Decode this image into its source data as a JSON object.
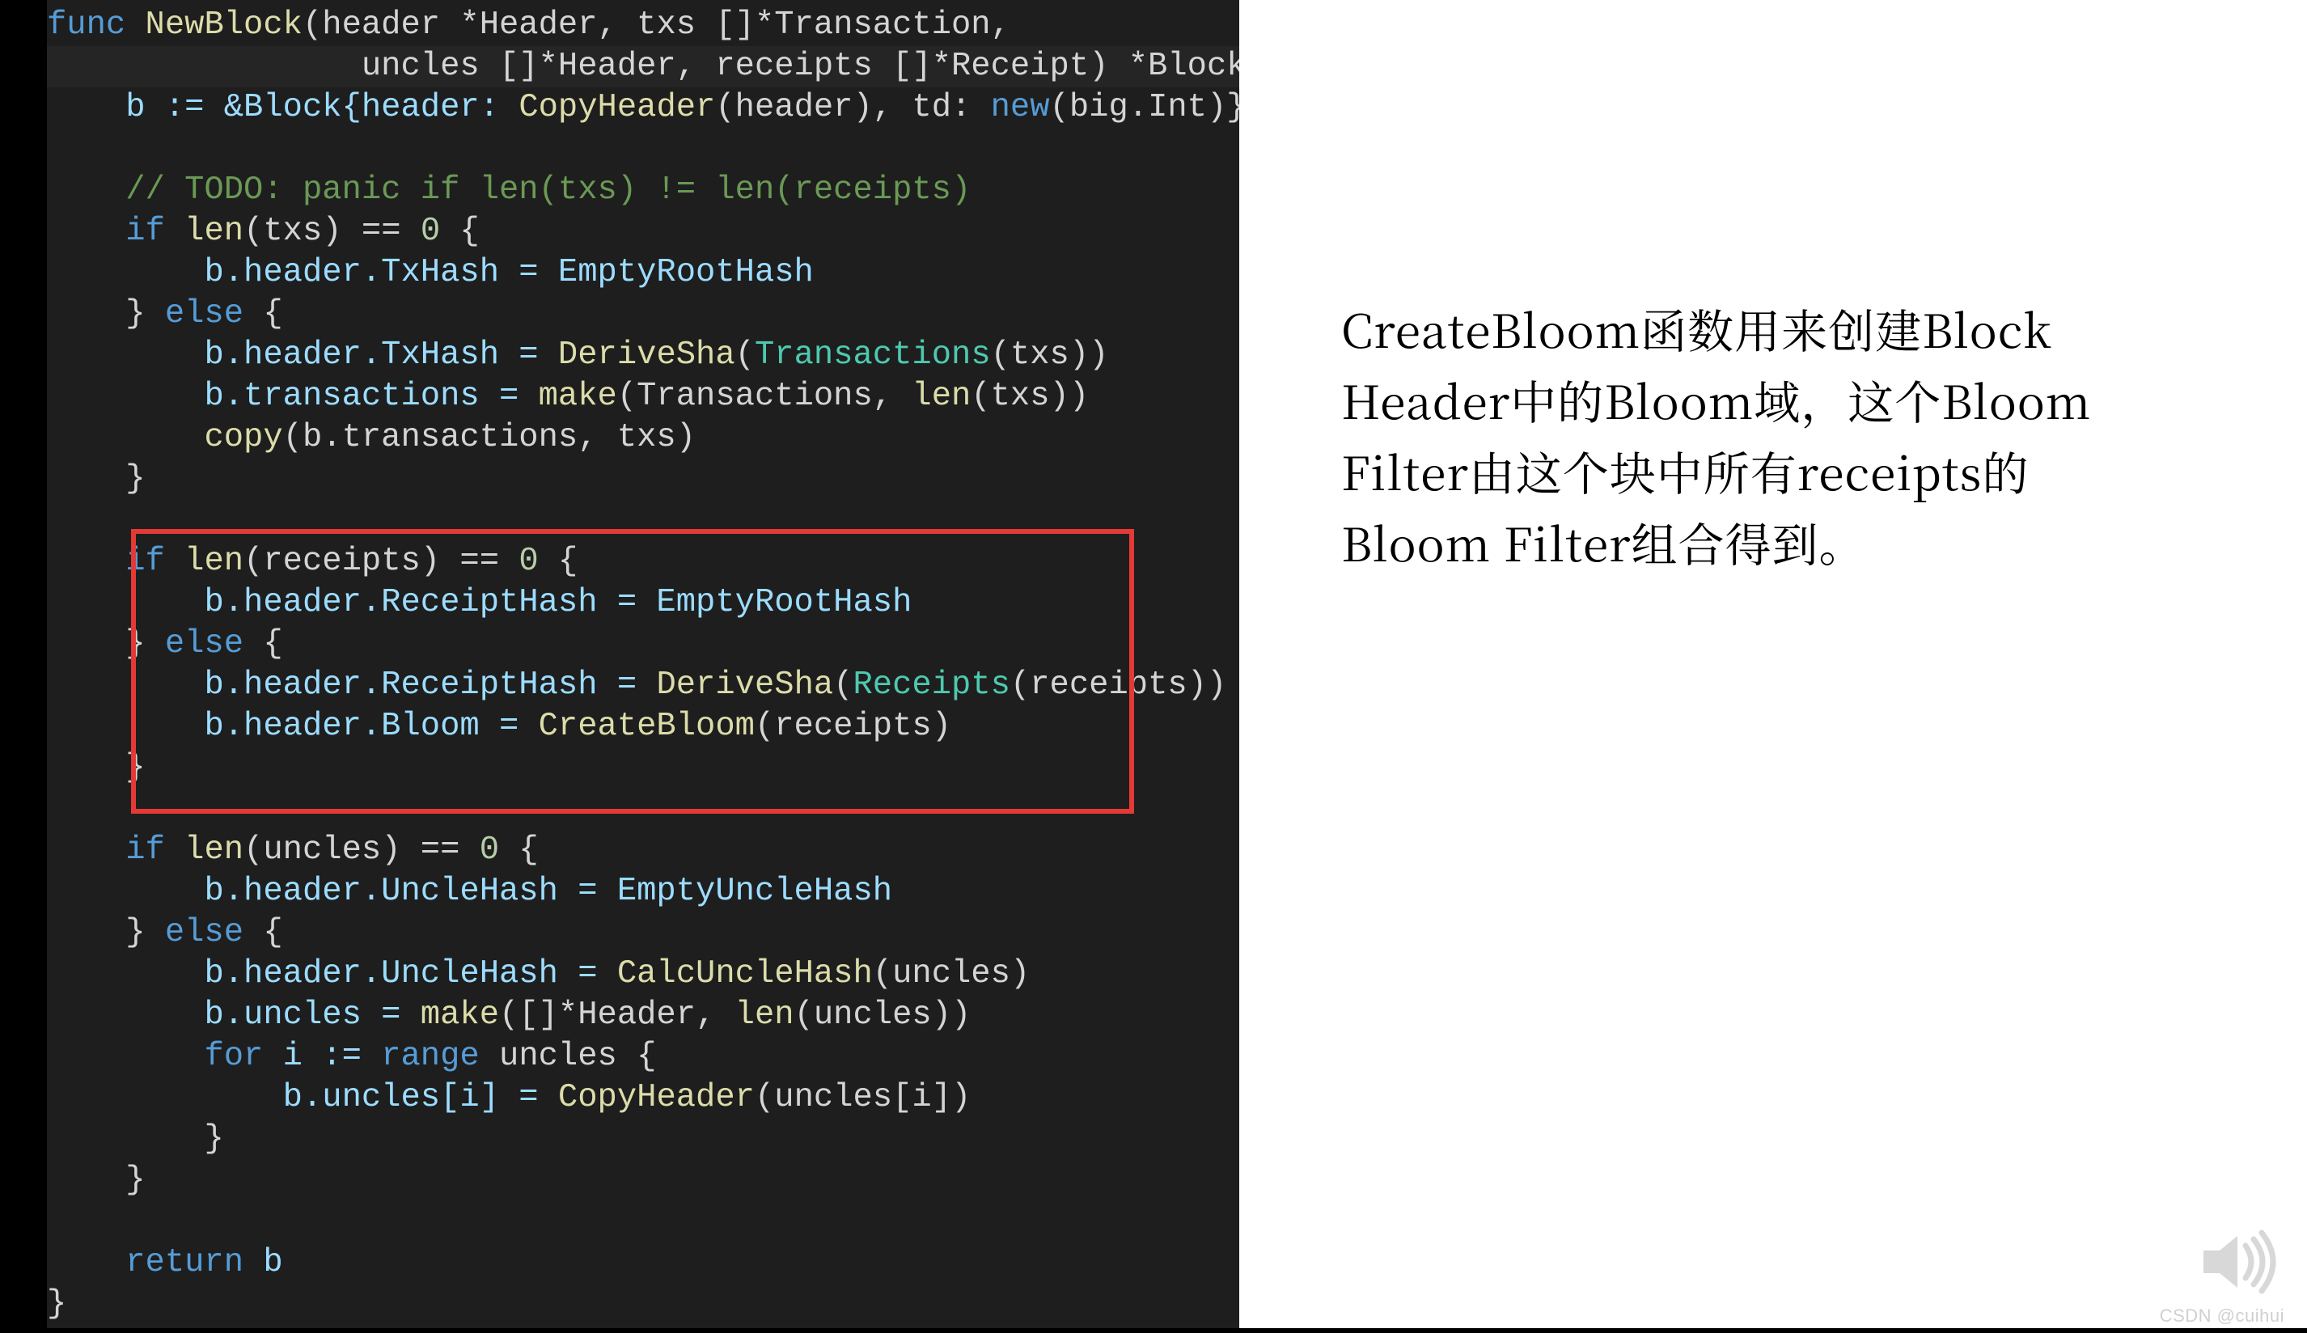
{
  "code": {
    "l1a": "func",
    "l1b": "NewBlock",
    "l1c": "(header *Header, txs []*Transaction,",
    "l2": "uncles []*Header, receipts []*Receipt) *Block {",
    "l3a": "b := &Block{header: ",
    "l3b": "CopyHeader",
    "l3c": "(header), td: ",
    "l3d": "new",
    "l3e": "(big.Int)}",
    "l5": "// TODO: panic if len(txs) != len(receipts)",
    "l6a": "if",
    "l6b": "len",
    "l6c": "(txs) == ",
    "l6d": "0",
    "l6e": " {",
    "l7": "b.header.TxHash = EmptyRootHash",
    "l8a": "} ",
    "l8b": "else",
    "l8c": " {",
    "l9a": "b.header.TxHash = ",
    "l9b": "DeriveSha",
    "l9c": "(",
    "l9d": "Transactions",
    "l9e": "(txs))",
    "l10a": "b.transactions = ",
    "l10b": "make",
    "l10c": "(Transactions, ",
    "l10d": "len",
    "l10e": "(txs))",
    "l11a": "copy",
    "l11b": "(b.transactions, txs)",
    "l12": "}",
    "l14a": "if",
    "l14b": "len",
    "l14c": "(receipts) == ",
    "l14d": "0",
    "l14e": " {",
    "l15": "b.header.ReceiptHash = EmptyRootHash",
    "l16a": "} ",
    "l16b": "else",
    "l16c": " {",
    "l17a": "b.header.ReceiptHash = ",
    "l17b": "DeriveSha",
    "l17c": "(",
    "l17d": "Receipts",
    "l17e": "(receipts))",
    "l18a": "b.header.Bloom = ",
    "l18b": "CreateBloom",
    "l18c": "(receipts)",
    "l19": "}",
    "l21a": "if",
    "l21b": "len",
    "l21c": "(uncles) == ",
    "l21d": "0",
    "l21e": " {",
    "l22": "b.header.UncleHash = EmptyUncleHash",
    "l23a": "} ",
    "l23b": "else",
    "l23c": " {",
    "l24a": "b.header.UncleHash = ",
    "l24b": "CalcUncleHash",
    "l24c": "(uncles)",
    "l25a": "b.uncles = ",
    "l25b": "make",
    "l25c": "([]*Header, ",
    "l25d": "len",
    "l25e": "(uncles))",
    "l26a": "for",
    "l26b": " i := ",
    "l26c": "range",
    "l26d": " uncles {",
    "l27a": "b.uncles[i] = ",
    "l27b": "CopyHeader",
    "l27c": "(uncles[i])",
    "l28": "}",
    "l29": "}",
    "l31a": "return",
    "l31b": " b",
    "l32": "}"
  },
  "explanation": "CreateBloom函数用来创建Block Header中的Bloom域，这个Bloom Filter由这个块中所有receipts的Bloom Filter组合得到。",
  "watermark": "CSDN @cuihui"
}
